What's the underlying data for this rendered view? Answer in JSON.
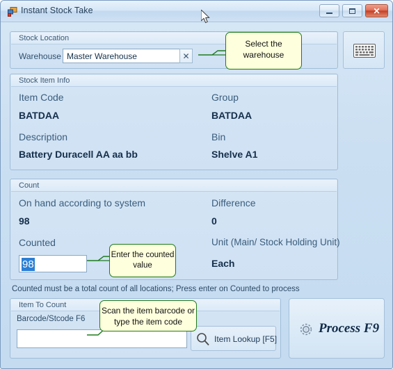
{
  "window": {
    "title": "Instant Stock Take",
    "icon": "app-window-icon",
    "controls": {
      "minimize": "minimize",
      "maximize": "maximize",
      "close": "✕"
    }
  },
  "stock_location": {
    "group_title": "Stock Location",
    "warehouse_label": "Warehouse",
    "warehouse_value": "Master Warehouse",
    "warehouse_placeholder": "Master Warehouse",
    "clear_label": "✕",
    "dropdown_icon": "chevron-down-icon",
    "keyboard_button_icon": "keyboard-icon"
  },
  "stock_item_info": {
    "group_title": "Stock Item Info",
    "item_code_label": "Item Code",
    "item_code_value": "BATDAA",
    "group_label": "Group",
    "group_value": "BATDAA",
    "description_label": "Description",
    "description_value": "Battery Duracell AA aa bb",
    "bin_label": "Bin",
    "bin_value": "Shelve A1"
  },
  "count": {
    "group_title": "Count",
    "on_hand_label": "On hand according to system",
    "on_hand_value": "98",
    "difference_label": "Difference",
    "difference_value": "0",
    "counted_label": "Counted",
    "counted_value": "98",
    "counted_placeholder": "",
    "unit_label": "Unit (Main/ Stock Holding Unit)",
    "unit_value": "Each"
  },
  "status_text": "Counted must be a total count of all locations; Press enter on Counted to process",
  "item_to_count": {
    "group_title": "Item To Count",
    "barcode_label": "Barcode/Stcode F6",
    "barcode_value": "",
    "barcode_placeholder": "",
    "lookup_button_label": "Item Lookup [F5]",
    "lookup_icon": "magnifier-icon"
  },
  "process": {
    "label": "Process F9",
    "icon": "gear-icon"
  },
  "callouts": {
    "warehouse": "Select the warehouse",
    "counted": "Enter the counted value",
    "barcode": "Scan the item barcode or type the item code"
  },
  "colors": {
    "window_bg": "#cbdff2",
    "group_bg": "#d3e4f4",
    "border": "#9fbdd8",
    "label_text": "#3a5d7d",
    "value_text": "#152f4b",
    "callout_bg": "#feffdd",
    "callout_border": "#1d7a1d",
    "selection_blue": "#2a7fd4",
    "close_red": "#c43f26"
  }
}
